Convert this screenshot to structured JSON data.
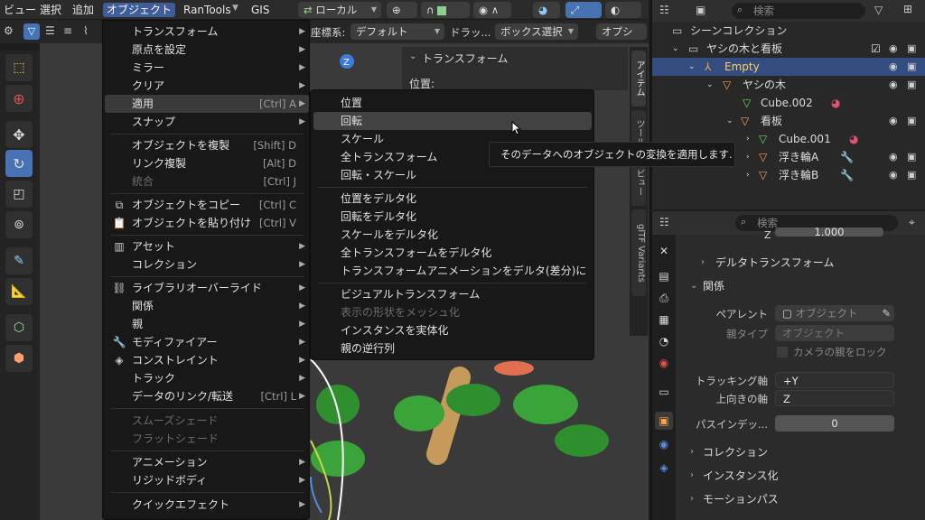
{
  "topbar": {
    "menus": [
      "ビュー",
      "選択",
      "追加",
      "オブジェクト",
      "RanTools",
      "GIS"
    ],
    "orientation": "ローカル"
  },
  "header2": {
    "coord_label": "座標系:",
    "coord_value": "デフォルト",
    "drag_label": "ドラッ...",
    "drag_value": "ボックス選択",
    "options_label": "オプショ..."
  },
  "npanel": {
    "section": "トランスフォーム",
    "position_label": "位置:"
  },
  "ntabs": [
    "アイテム",
    "ツール",
    "ビュー",
    "glTF Variants"
  ],
  "object_menu": {
    "items": [
      {
        "label": "トランスフォーム",
        "shortcut": "",
        "submenu": true
      },
      {
        "label": "原点を設定",
        "shortcut": "",
        "submenu": true
      },
      {
        "label": "ミラー",
        "shortcut": "",
        "submenu": true
      },
      {
        "label": "クリア",
        "shortcut": "",
        "submenu": true
      },
      {
        "label": "適用",
        "shortcut": "[Ctrl] A",
        "submenu": true
      },
      {
        "label": "スナップ",
        "shortcut": "",
        "submenu": true
      },
      {
        "label": "オブジェクトを複製",
        "shortcut": "[Shift] D",
        "submenu": false
      },
      {
        "label": "リンク複製",
        "shortcut": "[Alt] D",
        "submenu": false
      },
      {
        "label": "統合",
        "shortcut": "[Ctrl] J",
        "submenu": false
      },
      {
        "label": "オブジェクトをコピー",
        "shortcut": "[Ctrl] C",
        "submenu": false
      },
      {
        "label": "オブジェクトを貼り付け",
        "shortcut": "[Ctrl] V",
        "submenu": false
      },
      {
        "label": "アセット",
        "shortcut": "",
        "submenu": true
      },
      {
        "label": "コレクション",
        "shortcut": "",
        "submenu": true
      },
      {
        "label": "ライブラリオーバーライド",
        "shortcut": "",
        "submenu": true
      },
      {
        "label": "関係",
        "shortcut": "",
        "submenu": true
      },
      {
        "label": "親",
        "shortcut": "",
        "submenu": true
      },
      {
        "label": "モディファイアー",
        "shortcut": "",
        "submenu": true
      },
      {
        "label": "コンストレイント",
        "shortcut": "",
        "submenu": true
      },
      {
        "label": "トラック",
        "shortcut": "",
        "submenu": true
      },
      {
        "label": "データのリンク/転送",
        "shortcut": "[Ctrl] L",
        "submenu": true
      },
      {
        "label": "スムーズシェード",
        "shortcut": "",
        "submenu": false
      },
      {
        "label": "フラットシェード",
        "shortcut": "",
        "submenu": false
      },
      {
        "label": "アニメーション",
        "shortcut": "",
        "submenu": true
      },
      {
        "label": "リジッドボディ",
        "shortcut": "",
        "submenu": true
      },
      {
        "label": "クイックエフェクト",
        "shortcut": "",
        "submenu": true
      }
    ]
  },
  "apply_menu": {
    "items": [
      "位置",
      "回転",
      "スケール",
      "全トランスフォーム",
      "回転・スケール",
      "位置をデルタ化",
      "回転をデルタ化",
      "スケールをデルタ化",
      "全トランスフォームをデルタ化",
      "トランスフォームアニメーションをデルタ(差分)に",
      "ビジュアルトランスフォーム",
      "表示の形状をメッシュ化",
      "インスタンスを実体化",
      "親の逆行列"
    ]
  },
  "tooltip": "そのデータへのオブジェクトの変換を適用します.",
  "outliner": {
    "search_placeholder": "検索",
    "rows": [
      "シーンコレクション",
      "ヤシの木と看板",
      "Empty",
      "ヤシの木",
      "Cube.002",
      "看板",
      "Cube.001",
      "浮き輪A",
      "浮き輪B"
    ]
  },
  "properties": {
    "search_placeholder": "検索",
    "z_value": "1.000",
    "delta_section": "デルタトランスフォーム",
    "relations_section": "関係",
    "parent_label": "ペアレント",
    "parent_value": "オブジェクト",
    "parent_type_label": "親タイプ",
    "parent_type_value": "オブジェクト",
    "camera_lock": "カメラの親をロック",
    "tracking_label": "トラッキング軸",
    "tracking_value": "+Y",
    "up_label": "上向きの軸",
    "up_value": "Z",
    "pass_label": "パスインデッ...",
    "pass_value": "0",
    "collection_section": "コレクション",
    "instancing_section": "インスタンス化",
    "motion_section": "モーションパス"
  },
  "colors": {
    "accent": "#4772b3",
    "menu_bg": "#181818",
    "selected_row": "#334d80"
  }
}
